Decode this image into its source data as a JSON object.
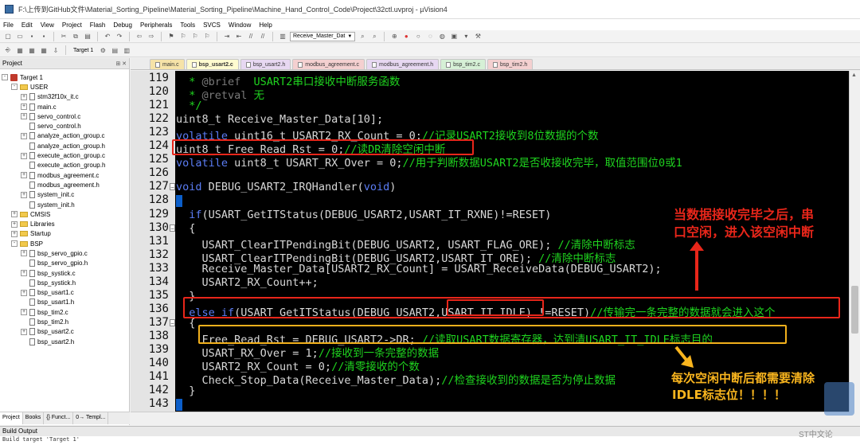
{
  "window": {
    "title": "F:\\上传到GitHub文件\\Material_Sorting_Pipeline\\Material_Sorting_Pipeline\\Machine_Hand_Control_Code\\Project\\32ctl.uvproj - µVision4"
  },
  "menu": [
    "File",
    "Edit",
    "View",
    "Project",
    "Flash",
    "Debug",
    "Peripherals",
    "Tools",
    "SVCS",
    "Window",
    "Help"
  ],
  "toolbar": {
    "function_combo": "Receive_Master_Dat",
    "target_combo": "Target 1"
  },
  "project": {
    "header": "Project",
    "tree": [
      {
        "label": "Target 1",
        "level": 0,
        "type": "target",
        "exp": "-"
      },
      {
        "label": "USER",
        "level": 1,
        "type": "folder",
        "exp": "-"
      },
      {
        "label": "stm32f10x_it.c",
        "level": 2,
        "type": "file",
        "exp": "+"
      },
      {
        "label": "main.c",
        "level": 2,
        "type": "file",
        "exp": "+"
      },
      {
        "label": "servo_control.c",
        "level": 2,
        "type": "file",
        "exp": "+"
      },
      {
        "label": "servo_control.h",
        "level": 2,
        "type": "file",
        "exp": ""
      },
      {
        "label": "analyze_action_group.c",
        "level": 2,
        "type": "file",
        "exp": "+"
      },
      {
        "label": "analyze_action_group.h",
        "level": 2,
        "type": "file",
        "exp": ""
      },
      {
        "label": "execute_action_group.c",
        "level": 2,
        "type": "file",
        "exp": "+"
      },
      {
        "label": "execute_action_group.h",
        "level": 2,
        "type": "file",
        "exp": ""
      },
      {
        "label": "modbus_agreement.c",
        "level": 2,
        "type": "file",
        "exp": "+"
      },
      {
        "label": "modbus_agreement.h",
        "level": 2,
        "type": "file",
        "exp": ""
      },
      {
        "label": "system_init.c",
        "level": 2,
        "type": "file",
        "exp": "+"
      },
      {
        "label": "system_init.h",
        "level": 2,
        "type": "file",
        "exp": ""
      },
      {
        "label": "CMSIS",
        "level": 1,
        "type": "folder",
        "exp": "+"
      },
      {
        "label": "Libraries",
        "level": 1,
        "type": "folder",
        "exp": "+"
      },
      {
        "label": "Startup",
        "level": 1,
        "type": "folder",
        "exp": "+"
      },
      {
        "label": "BSP",
        "level": 1,
        "type": "folder",
        "exp": "-"
      },
      {
        "label": "bsp_servo_gpio.c",
        "level": 2,
        "type": "file",
        "exp": "+"
      },
      {
        "label": "bsp_servo_gpio.h",
        "level": 2,
        "type": "file",
        "exp": ""
      },
      {
        "label": "bsp_systick.c",
        "level": 2,
        "type": "file",
        "exp": "+"
      },
      {
        "label": "bsp_systick.h",
        "level": 2,
        "type": "file",
        "exp": ""
      },
      {
        "label": "bsp_usart1.c",
        "level": 2,
        "type": "file",
        "exp": "+"
      },
      {
        "label": "bsp_usart1.h",
        "level": 2,
        "type": "file",
        "exp": ""
      },
      {
        "label": "bsp_tim2.c",
        "level": 2,
        "type": "file",
        "exp": "+"
      },
      {
        "label": "bsp_tim2.h",
        "level": 2,
        "type": "file",
        "exp": ""
      },
      {
        "label": "bsp_usart2.c",
        "level": 2,
        "type": "file",
        "exp": "+"
      },
      {
        "label": "bsp_usart2.h",
        "level": 2,
        "type": "file",
        "exp": ""
      }
    ],
    "tabs": [
      "Project",
      "Books",
      "{} Funct...",
      "0→ Templ..."
    ]
  },
  "editor_tabs": [
    {
      "label": "main.c",
      "active": false,
      "color": "#f6e3a8"
    },
    {
      "label": "bsp_usart2.c",
      "active": true,
      "color": "#fffbd0"
    },
    {
      "label": "bsp_usart2.h",
      "active": false,
      "color": "#e7d8f2"
    },
    {
      "label": "modbus_agreement.c",
      "active": false,
      "color": "#f4d0d0"
    },
    {
      "label": "modbus_agreement.h",
      "active": false,
      "color": "#e7d8f2"
    },
    {
      "label": "bsp_tim2.c",
      "active": false,
      "color": "#d6f0d6"
    },
    {
      "label": "bsp_tim2.h",
      "active": false,
      "color": "#f4d0d0"
    }
  ],
  "code_lines": [
    {
      "num": "119",
      "text": [
        [
          "cm",
          "  * "
        ],
        [
          "cmt",
          "@brief"
        ],
        [
          "cm",
          "  USART2串口接收中断服务函数"
        ]
      ]
    },
    {
      "num": "120",
      "text": [
        [
          "cm",
          "  * "
        ],
        [
          "cmt",
          "@retval"
        ],
        [
          "cm",
          " 无"
        ]
      ]
    },
    {
      "num": "121",
      "text": [
        [
          "cm",
          "  */"
        ]
      ]
    },
    {
      "num": "122",
      "text": [
        [
          "pl",
          "uint8_t Receive_Master_Data[10];"
        ]
      ]
    },
    {
      "num": "123",
      "text": [
        [
          "kw",
          "volatile"
        ],
        [
          "pl",
          " uint16_t USART2_RX_Count = 0;"
        ],
        [
          "cm",
          "//记录USART2接收到8位数据的个数"
        ]
      ]
    },
    {
      "num": "124",
      "text": [
        [
          "pl",
          "uint8_t Free_Read_Rst = 0;"
        ],
        [
          "cm",
          "//读DR清除空闲中断"
        ]
      ]
    },
    {
      "num": "125",
      "text": [
        [
          "kw",
          "volatile"
        ],
        [
          "pl",
          " uint8_t USART_RX_Over = 0;"
        ],
        [
          "cm",
          "//用于判断数据USART2是否收接收完毕，取值范围位0或1"
        ]
      ]
    },
    {
      "num": "126",
      "text": [
        [
          "pl",
          ""
        ]
      ]
    },
    {
      "num": "127",
      "text": [
        [
          "kw",
          "void"
        ],
        [
          "pl",
          " DEBUG_USART2_IRQHandler("
        ],
        [
          "kw",
          "void"
        ],
        [
          "pl",
          ")"
        ]
      ]
    },
    {
      "num": "128",
      "text": [
        [
          "pl",
          "{"
        ]
      ]
    },
    {
      "num": "129",
      "text": [
        [
          "pl",
          "  "
        ],
        [
          "kw",
          "if"
        ],
        [
          "pl",
          "(USART_GetITStatus(DEBUG_USART2,USART_IT_RXNE)!=RESET)"
        ]
      ]
    },
    {
      "num": "130",
      "text": [
        [
          "pl",
          "  {"
        ]
      ]
    },
    {
      "num": "131",
      "text": [
        [
          "pl",
          "    USART_ClearITPendingBit(DEBUG_USART2, USART_FLAG_ORE); "
        ],
        [
          "cm",
          "//清除中断标志"
        ]
      ]
    },
    {
      "num": "132",
      "text": [
        [
          "pl",
          "    USART_ClearITPendingBit(DEBUG_USART2,USART_IT_ORE); "
        ],
        [
          "cm",
          "//清除中断标志"
        ]
      ]
    },
    {
      "num": "133",
      "text": [
        [
          "pl",
          "    Receive_Master_Data[USART2_RX_Count] = USART_ReceiveData(DEBUG_USART2);"
        ]
      ]
    },
    {
      "num": "134",
      "text": [
        [
          "pl",
          "    USART2_RX_Count++;"
        ]
      ]
    },
    {
      "num": "135",
      "text": [
        [
          "pl",
          "  }"
        ]
      ]
    },
    {
      "num": "136",
      "text": [
        [
          "kw",
          "  else if"
        ],
        [
          "pl",
          "(USART_GetITStatus(DEBUG_USART2,USART_IT_IDLE) !=RESET)"
        ],
        [
          "cm",
          "//传输完一条完整的数据就会进入这个"
        ]
      ]
    },
    {
      "num": "137",
      "text": [
        [
          "pl",
          "  {"
        ]
      ]
    },
    {
      "num": "138",
      "text": [
        [
          "pl",
          "    Free_Read_Rst = DEBUG_USART2->DR; "
        ],
        [
          "cm",
          "//读取USART数据寄存器，达到清USART_IT_IDLE标志目的"
        ]
      ]
    },
    {
      "num": "139",
      "text": [
        [
          "pl",
          "    USART_RX_Over = 1;"
        ],
        [
          "cm",
          "//接收到一条完整的数据"
        ]
      ]
    },
    {
      "num": "140",
      "text": [
        [
          "pl",
          "    USART2_RX_Count = 0;"
        ],
        [
          "cm",
          "//清零接收的个数"
        ]
      ]
    },
    {
      "num": "141",
      "text": [
        [
          "pl",
          "    Check_Stop_Data(Receive_Master_Data);"
        ],
        [
          "cm",
          "//检查接收到的数据是否为停止数据"
        ]
      ]
    },
    {
      "num": "142",
      "text": [
        [
          "pl",
          "  }"
        ]
      ]
    },
    {
      "num": "143",
      "text": [
        [
          "pl",
          "}"
        ]
      ]
    }
  ],
  "annotations": {
    "red_note": [
      "当数据接收完毕之后，串",
      "口空闲，进入该空闲中断"
    ],
    "yellow_note": [
      "每次空闲中断后都需要清除",
      "IDLE标志位！！！！"
    ]
  },
  "colors": {
    "keyword": "#5b7df5",
    "comment": "#1fd41f",
    "code": "#d8d8d8",
    "annotation_red": "#e8261a",
    "annotation_yellow": "#f9b51e"
  },
  "build_output": {
    "header": "Build Output",
    "line": "Build target 'Target 1'"
  },
  "watermark": "ST中文论"
}
